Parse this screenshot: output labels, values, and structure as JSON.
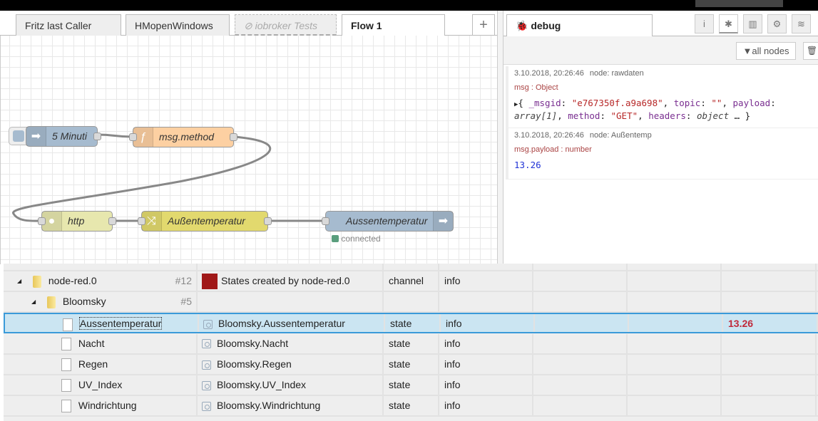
{
  "tabs": [
    {
      "label": "Fritz last Caller",
      "state": "normal"
    },
    {
      "label": "HMopenWindows",
      "state": "normal"
    },
    {
      "label": "iobroker Tests",
      "state": "disabled"
    },
    {
      "label": "Flow 1",
      "state": "active"
    }
  ],
  "add_tab_icon": "plus-icon",
  "flow": {
    "nodes": [
      {
        "label": "5 Minuti",
        "type": "inject",
        "color": "#a6bbcf",
        "icon": "arrow-right-icon"
      },
      {
        "label": "msg.method",
        "type": "function",
        "color": "#fdd0a2",
        "icon": "function-icon"
      },
      {
        "label": "http",
        "type": "http request",
        "color": "#e7e7ae",
        "icon": "globe-icon"
      },
      {
        "label": "Außentemperatur",
        "type": "change",
        "color": "#e2d96e",
        "icon": "shuffle-icon"
      },
      {
        "label": "Aussentemperatur",
        "type": "mqtt out",
        "color": "#a6bbcf",
        "icon": "arrow-right-icon"
      }
    ],
    "status": {
      "text": "connected",
      "color": "#5a9e7d"
    }
  },
  "sidebar": {
    "tab_label": "debug",
    "buttons": [
      "info-icon",
      "bug-icon",
      "chart-icon",
      "gear-icon",
      "database-icon"
    ],
    "filter_label": "all nodes",
    "messages": [
      {
        "time": "3.10.2018, 20:26:46",
        "node": "node: rawdaten",
        "type": "msg : Object",
        "body": {
          "msgid_key": "_msgid",
          "msgid": "\"e767350f.a9a698\"",
          "topic_key": "topic",
          "topic": "\"\"",
          "payload_key": "payload",
          "payload": "array[1]",
          "method_key": "method",
          "method": "\"GET\"",
          "headers_key": "headers",
          "headers": "object"
        }
      },
      {
        "time": "3.10.2018, 20:26:46",
        "node": "node: Außentemp",
        "type": "msg.payload : number",
        "value": "13.26"
      }
    ]
  },
  "objects": {
    "rows": [
      {
        "name": "node-red.0",
        "count": "#12",
        "desc": "States created by node-red.0",
        "type": "channel",
        "role": "info",
        "value": "",
        "kind": "folder",
        "level": 0
      },
      {
        "name": "Bloomsky",
        "count": "#5",
        "desc": "",
        "type": "",
        "role": "",
        "value": "",
        "kind": "folder",
        "level": 1
      },
      {
        "name": "Aussentemperatur",
        "count": "",
        "desc": "Bloomsky.Aussentemperatur",
        "type": "state",
        "role": "info",
        "value": "13.26",
        "kind": "file",
        "level": 2,
        "selected": true
      },
      {
        "name": "Nacht",
        "count": "",
        "desc": "Bloomsky.Nacht",
        "type": "state",
        "role": "info",
        "value": "",
        "kind": "file",
        "level": 2
      },
      {
        "name": "Regen",
        "count": "",
        "desc": "Bloomsky.Regen",
        "type": "state",
        "role": "info",
        "value": "",
        "kind": "file",
        "level": 2
      },
      {
        "name": "UV_Index",
        "count": "",
        "desc": "Bloomsky.UV_Index",
        "type": "state",
        "role": "info",
        "value": "",
        "kind": "file",
        "level": 2
      },
      {
        "name": "Windrichtung",
        "count": "",
        "desc": "Bloomsky.Windrichtung",
        "type": "state",
        "role": "info",
        "value": "",
        "kind": "file",
        "level": 2
      }
    ],
    "value_color": "#c0283a"
  }
}
